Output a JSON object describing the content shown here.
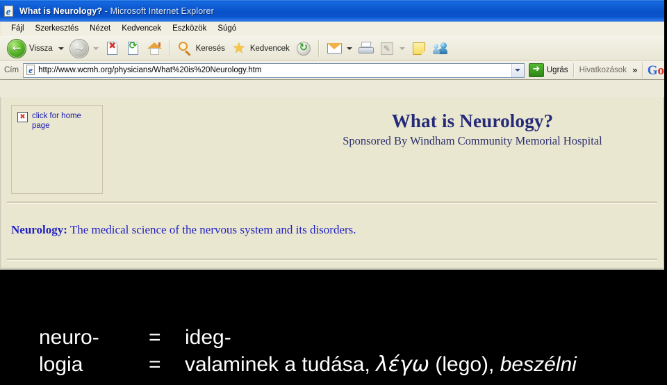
{
  "window": {
    "title_page": "What is Neurology?",
    "title_app": " - Microsoft Internet Explorer",
    "icon": "ie-document-icon"
  },
  "menu": {
    "items": [
      {
        "label": "Fájl"
      },
      {
        "label": "Szerkesztés"
      },
      {
        "label": "Nézet"
      },
      {
        "label": "Kedvencek"
      },
      {
        "label": "Eszközök"
      },
      {
        "label": "Súgó"
      }
    ]
  },
  "toolbar": {
    "back_label": "Vissza",
    "search_label": "Keresés",
    "favorites_label": "Kedvencek",
    "icons": {
      "back": "back-arrow-icon",
      "forward": "forward-arrow-icon",
      "stop": "stop-icon",
      "refresh": "refresh-icon",
      "home": "home-icon",
      "search": "magnifier-icon",
      "favorites": "star-icon",
      "history": "history-icon",
      "mail": "mail-icon",
      "print": "printer-icon",
      "edit": "edit-icon",
      "note": "note-icon",
      "messenger": "messenger-icon"
    }
  },
  "addressbar": {
    "label": "Cím",
    "url": "http://www.wcmh.org/physicians/What%20is%20Neurology.htm",
    "go_label": "Ugrás",
    "links_label": "Hivatkozások",
    "overflow": "»",
    "google_g": "G",
    "google_o": "o"
  },
  "page": {
    "broken_image_alt": "click for home page",
    "title": "What is Neurology?",
    "subtitle": "Sponsored By Windham Community Memorial Hospital",
    "definition_term": "Neurology:",
    "definition_text": " The medical science of the nervous system and its disorders."
  },
  "overlay": {
    "rows": [
      {
        "term": "neuro-",
        "eq": "=",
        "def_plain": "ideg-",
        "def_greek": "",
        "def_paren": "",
        "def_tail": ""
      },
      {
        "term": "logia",
        "eq": "=",
        "def_plain": "valaminek a tudása, ",
        "def_greek": "λέγω",
        "def_paren": " (lego), ",
        "def_tail": "beszélni"
      }
    ]
  },
  "colors": {
    "titlebar_blue": "#0b55cd",
    "page_cream": "#eae7d0",
    "heading_navy": "#242a78",
    "definition_blue": "#1f1fc4",
    "link_blue": "#1a1ab0",
    "chrome_beige": "#ece9d8"
  }
}
